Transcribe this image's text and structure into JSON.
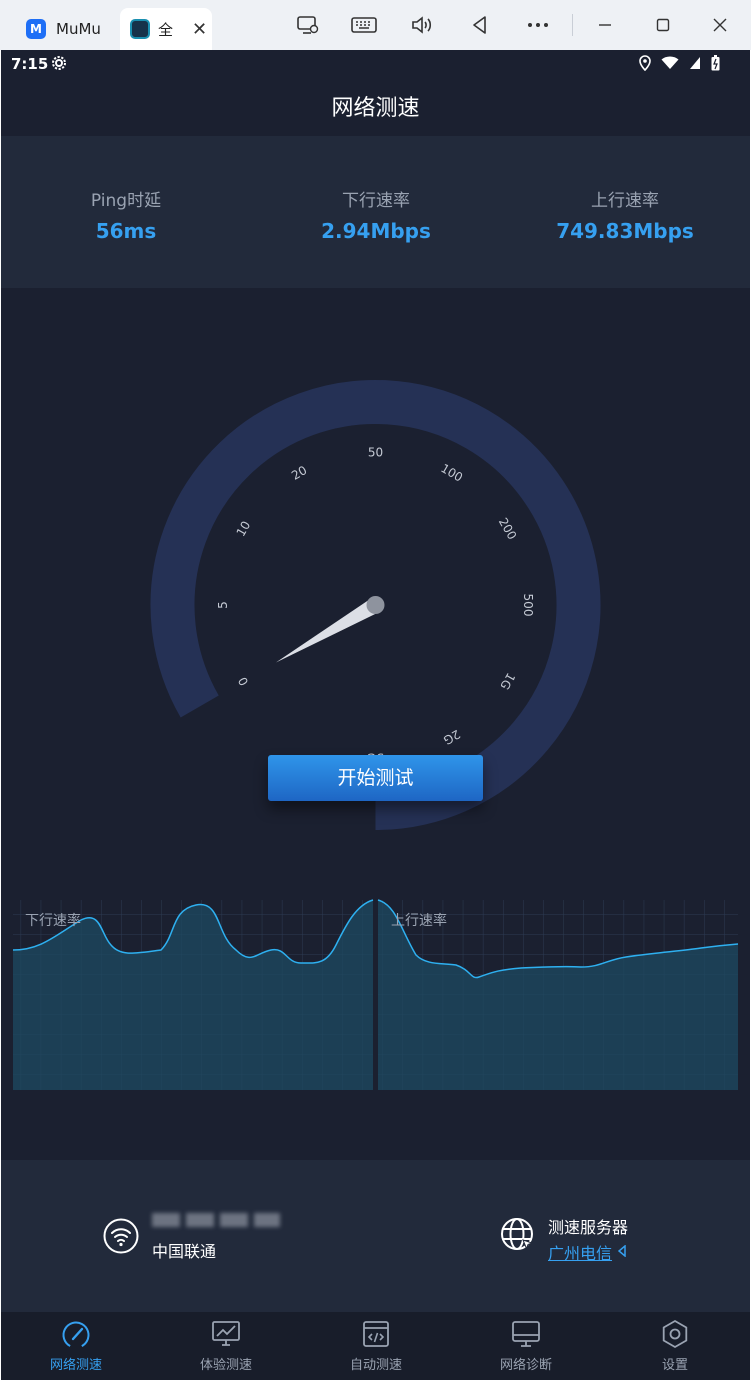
{
  "window": {
    "tabs": [
      {
        "title": "MuMu"
      },
      {
        "title": "全"
      }
    ],
    "toolbar_icons": [
      "screen-cast-icon",
      "keyboard-icon",
      "volume-icon",
      "back-triangle-icon",
      "more-icon"
    ],
    "controls": [
      "minimize-icon",
      "maximize-icon",
      "close-icon"
    ]
  },
  "status_bar": {
    "time": "7:15"
  },
  "app_title": "网络测速",
  "stats": [
    {
      "label": "Ping时延",
      "value": "56ms"
    },
    {
      "label": "下行速率",
      "value": "2.94Mbps"
    },
    {
      "label": "上行速率",
      "value": "749.83Mbps"
    }
  ],
  "gauge": {
    "ticks": [
      "0",
      "5",
      "10",
      "20",
      "50",
      "100",
      "200",
      "500",
      "1G",
      "2G",
      "5G"
    ],
    "needle_fraction": 0.0
  },
  "start_button": "开始测试",
  "graphs": {
    "download_label": "下行速率",
    "upload_label": "上行速率"
  },
  "network": {
    "carrier": "中国联通",
    "server_label": "测速服务器",
    "server_value": "广州电信"
  },
  "bottom_nav": [
    {
      "label": "网络测速",
      "icon": "speedometer-icon",
      "active": true
    },
    {
      "label": "体验测速",
      "icon": "chart-monitor-icon",
      "active": false
    },
    {
      "label": "自动测速",
      "icon": "code-window-icon",
      "active": false
    },
    {
      "label": "网络诊断",
      "icon": "monitor-icon",
      "active": false
    },
    {
      "label": "设置",
      "icon": "settings-hexagon-icon",
      "active": false
    }
  ],
  "colors": {
    "accent": "#36a0f0",
    "background": "#1b2030",
    "panel": "#222a3b",
    "gauge_track": "#253155"
  }
}
